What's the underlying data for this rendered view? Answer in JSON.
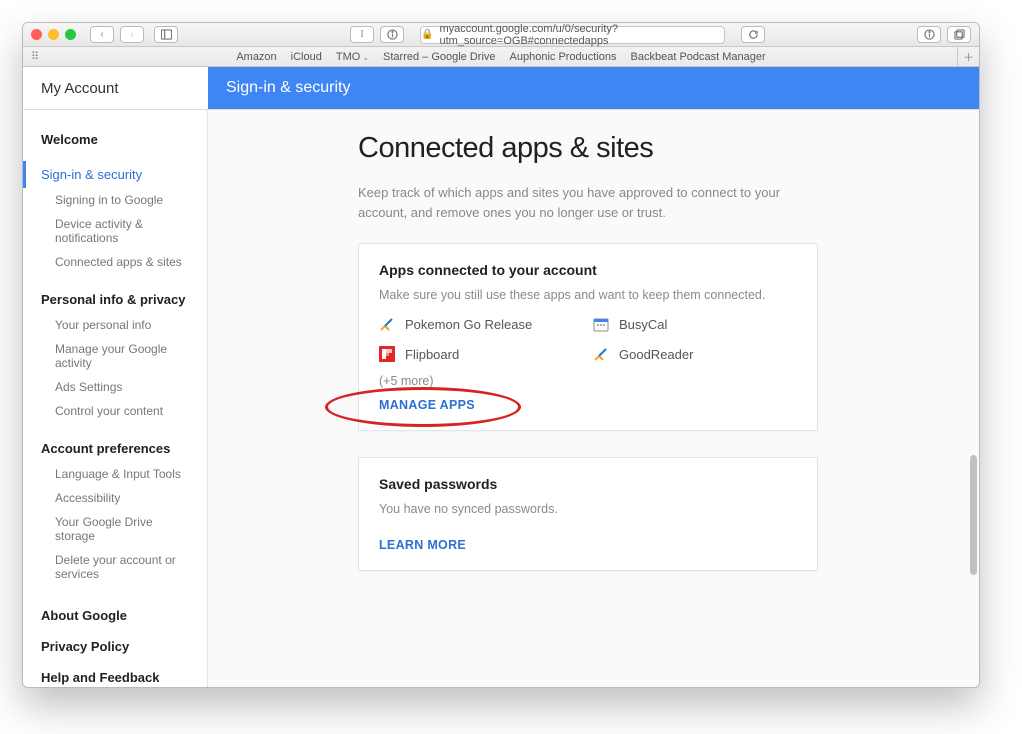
{
  "address_bar": "myaccount.google.com/u/0/security?utm_source=OGB#connectedapps",
  "bookmarks": [
    "Amazon",
    "iCloud",
    "TMO",
    "Starred – Google Drive",
    "Auphonic Productions",
    "Backbeat Podcast Manager"
  ],
  "header": {
    "left": "My Account",
    "right": "Sign-in & security"
  },
  "sidebar": {
    "welcome": "Welcome",
    "signin": {
      "label": "Sign-in & security",
      "items": [
        "Signing in to Google",
        "Device activity & notifications",
        "Connected apps & sites"
      ]
    },
    "personal": {
      "label": "Personal info & privacy",
      "items": [
        "Your personal info",
        "Manage your Google activity",
        "Ads Settings",
        "Control your content"
      ]
    },
    "prefs": {
      "label": "Account preferences",
      "items": [
        "Language & Input Tools",
        "Accessibility",
        "Your Google Drive storage",
        "Delete your account or services"
      ]
    },
    "footer": [
      "About Google",
      "Privacy Policy",
      "Help and Feedback"
    ]
  },
  "page": {
    "title": "Connected apps & sites",
    "desc": "Keep track of which apps and sites you have approved to connect to your account, and remove ones you no longer use or trust."
  },
  "apps_card": {
    "title": "Apps connected to your account",
    "sub": "Make sure you still use these apps and want to keep them connected.",
    "apps": [
      "Pokemon Go Release",
      "BusyCal",
      "Flipboard",
      "GoodReader"
    ],
    "more": "(+5 more)",
    "link": "MANAGE APPS"
  },
  "pw_card": {
    "title": "Saved passwords",
    "sub": "You have no synced passwords.",
    "link": "LEARN MORE"
  }
}
